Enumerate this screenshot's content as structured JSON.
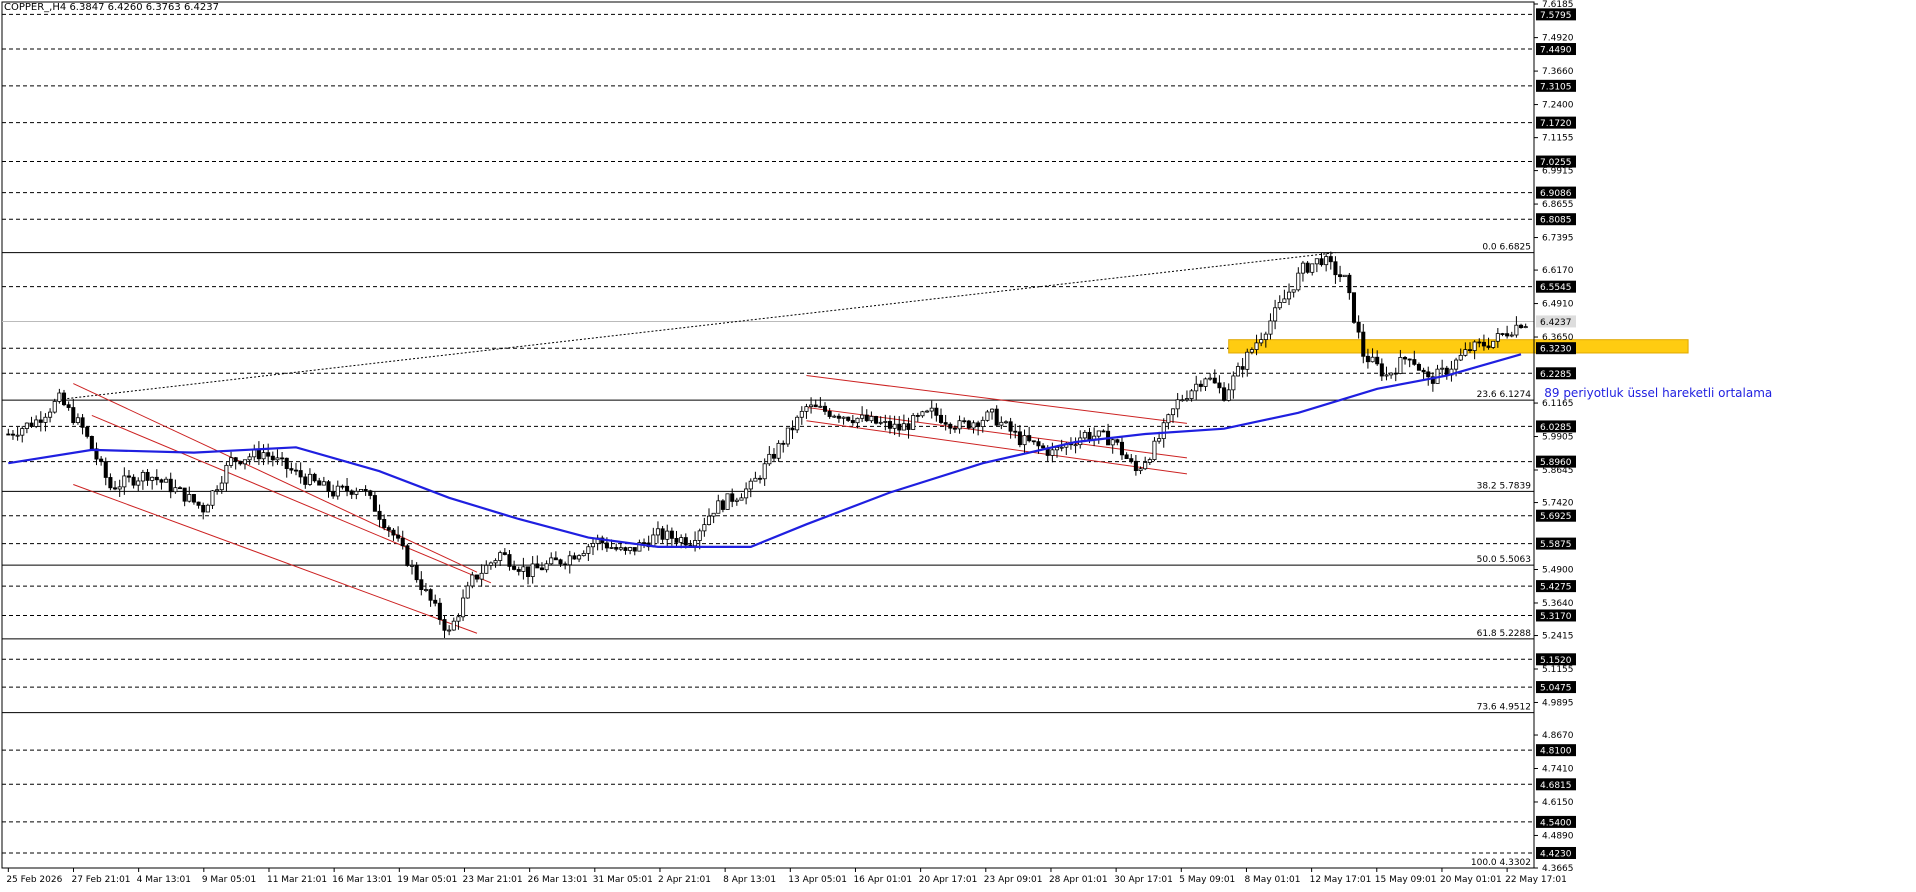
{
  "header": {
    "symbol": "COPPER_,H4",
    "ohlc": "6.3847 6.4260 6.3763 6.4237"
  },
  "colors": {
    "background": "#ffffff",
    "axis": "#000000",
    "grid_dashed": "#000000",
    "candle": "#000000",
    "ema": "#1f1fe0",
    "channel": "#cc2222",
    "zone": "#ffcc11",
    "annotation": "#1f1fe0"
  },
  "chart_data": {
    "type": "candlestick",
    "symbol": "COPPER_",
    "timeframe": "H4",
    "ylim": [
      4.3665,
      7.6185
    ],
    "x_labels": [
      "25 Feb 2026",
      "27 Feb 21:01",
      "4 Mar 13:01",
      "9 Mar 05:01",
      "11 Mar 21:01",
      "16 Mar 13:01",
      "19 Mar 05:01",
      "23 Mar 21:01",
      "26 Mar 13:01",
      "31 Mar 05:01",
      "2 Apr 21:01",
      "8 Apr 13:01",
      "13 Apr 05:01",
      "16 Apr 01:01",
      "20 Apr 17:01",
      "23 Apr 09:01",
      "28 Apr 01:01",
      "30 Apr 17:01",
      "5 May 09:01",
      "8 May 01:01",
      "12 May 17:01",
      "15 May 09:01",
      "20 May 01:01",
      "22 May 17:01"
    ],
    "y_ticks_plain": [
      "7.6185",
      "7.4920",
      "7.3660",
      "7.2400",
      "7.1155",
      "6.9915",
      "6.8655",
      "6.7395",
      "6.6170",
      "6.4910",
      "6.3650",
      "6.1165",
      "5.9905",
      "5.8645",
      "5.7420",
      "5.4900",
      "5.3640",
      "5.2415",
      "5.1155",
      "4.9895",
      "4.8670",
      "4.7410",
      "4.6150",
      "4.4890",
      "4.3665"
    ],
    "levels": [
      {
        "value": 7.5795,
        "label": "7.5795"
      },
      {
        "value": 7.449,
        "label": "7.4490"
      },
      {
        "value": 7.3105,
        "label": "7.3105"
      },
      {
        "value": 7.172,
        "label": "7.1720"
      },
      {
        "value": 7.0255,
        "label": "7.0255"
      },
      {
        "value": 6.9086,
        "label": "6.9086"
      },
      {
        "value": 6.8085,
        "label": "6.8085"
      },
      {
        "value": 6.5545,
        "label": "6.5545"
      },
      {
        "value": 6.323,
        "label": "6.3230"
      },
      {
        "value": 6.2285,
        "label": "6.2285"
      },
      {
        "value": 6.0285,
        "label": "6.0285"
      },
      {
        "value": 5.896,
        "label": "5.8960"
      },
      {
        "value": 5.6925,
        "label": "5.6925"
      },
      {
        "value": 5.5875,
        "label": "5.5875"
      },
      {
        "value": 5.4275,
        "label": "5.4275"
      },
      {
        "value": 5.317,
        "label": "5.3170"
      },
      {
        "value": 5.152,
        "label": "5.1520"
      },
      {
        "value": 5.0475,
        "label": "5.0475"
      },
      {
        "value": 4.81,
        "label": "4.8100"
      },
      {
        "value": 4.6815,
        "label": "4.6815"
      },
      {
        "value": 4.54,
        "label": "4.5400"
      },
      {
        "value": 4.423,
        "label": "4.4230"
      }
    ],
    "current_price": {
      "value": 6.4237,
      "label": "6.4237"
    },
    "fibonacci": [
      {
        "value": 6.6825,
        "label": "0.0 6.6825"
      },
      {
        "value": 6.1274,
        "label": "23.6 6.1274"
      },
      {
        "value": 5.7839,
        "label": "38.2 5.7839"
      },
      {
        "value": 5.5063,
        "label": "50.0 5.5063"
      },
      {
        "value": 5.2288,
        "label": "61.8 5.2288"
      },
      {
        "value": 4.9512,
        "label": "73.6 4.9512"
      },
      {
        "value": 4.3302,
        "label": "100.0 4.3302"
      }
    ],
    "anchors": [
      {
        "t": 0,
        "v": 6.0
      },
      {
        "t": 6,
        "v": 6.05
      },
      {
        "t": 11,
        "v": 6.13
      },
      {
        "t": 16,
        "v": 6.02
      },
      {
        "t": 22,
        "v": 5.8
      },
      {
        "t": 30,
        "v": 5.85
      },
      {
        "t": 37,
        "v": 5.78
      },
      {
        "t": 42,
        "v": 5.72
      },
      {
        "t": 48,
        "v": 5.9
      },
      {
        "t": 55,
        "v": 5.93
      },
      {
        "t": 62,
        "v": 5.85
      },
      {
        "t": 70,
        "v": 5.78
      },
      {
        "t": 76,
        "v": 5.8
      },
      {
        "t": 83,
        "v": 5.62
      },
      {
        "t": 90,
        "v": 5.4
      },
      {
        "t": 95,
        "v": 5.25
      },
      {
        "t": 100,
        "v": 5.45
      },
      {
        "t": 106,
        "v": 5.55
      },
      {
        "t": 112,
        "v": 5.48
      },
      {
        "t": 120,
        "v": 5.53
      },
      {
        "t": 127,
        "v": 5.6
      },
      {
        "t": 133,
        "v": 5.55
      },
      {
        "t": 140,
        "v": 5.62
      },
      {
        "t": 147,
        "v": 5.6
      },
      {
        "t": 152,
        "v": 5.72
      },
      {
        "t": 160,
        "v": 5.8
      },
      {
        "t": 166,
        "v": 5.95
      },
      {
        "t": 172,
        "v": 6.1
      },
      {
        "t": 178,
        "v": 6.08
      },
      {
        "t": 185,
        "v": 6.05
      },
      {
        "t": 192,
        "v": 6.02
      },
      {
        "t": 199,
        "v": 6.08
      },
      {
        "t": 205,
        "v": 6.03
      },
      {
        "t": 212,
        "v": 6.07
      },
      {
        "t": 218,
        "v": 5.98
      },
      {
        "t": 225,
        "v": 5.93
      },
      {
        "t": 232,
        "v": 6.0
      },
      {
        "t": 238,
        "v": 5.98
      },
      {
        "t": 243,
        "v": 5.86
      },
      {
        "t": 247,
        "v": 5.95
      },
      {
        "t": 252,
        "v": 6.12
      },
      {
        "t": 258,
        "v": 6.22
      },
      {
        "t": 262,
        "v": 6.15
      },
      {
        "t": 268,
        "v": 6.32
      },
      {
        "t": 274,
        "v": 6.48
      },
      {
        "t": 279,
        "v": 6.62
      },
      {
        "t": 283,
        "v": 6.66
      },
      {
        "t": 288,
        "v": 6.58
      },
      {
        "t": 292,
        "v": 6.3
      },
      {
        "t": 297,
        "v": 6.22
      },
      {
        "t": 302,
        "v": 6.3
      },
      {
        "t": 306,
        "v": 6.2
      },
      {
        "t": 310,
        "v": 6.24
      },
      {
        "t": 315,
        "v": 6.32
      },
      {
        "t": 320,
        "v": 6.35
      },
      {
        "t": 326,
        "v": 6.42
      }
    ],
    "ema": {
      "name": "89 periyotluk üssel hareketli ortalama",
      "points": [
        {
          "t": 0,
          "v": 5.89
        },
        {
          "t": 18,
          "v": 5.94
        },
        {
          "t": 40,
          "v": 5.93
        },
        {
          "t": 62,
          "v": 5.95
        },
        {
          "t": 80,
          "v": 5.86
        },
        {
          "t": 95,
          "v": 5.76
        },
        {
          "t": 110,
          "v": 5.68
        },
        {
          "t": 125,
          "v": 5.61
        },
        {
          "t": 140,
          "v": 5.575
        },
        {
          "t": 160,
          "v": 5.575
        },
        {
          "t": 172,
          "v": 5.66
        },
        {
          "t": 190,
          "v": 5.78
        },
        {
          "t": 210,
          "v": 5.89
        },
        {
          "t": 230,
          "v": 5.97
        },
        {
          "t": 245,
          "v": 6.0
        },
        {
          "t": 262,
          "v": 6.02
        },
        {
          "t": 278,
          "v": 6.08
        },
        {
          "t": 295,
          "v": 6.17
        },
        {
          "t": 310,
          "v": 6.22
        },
        {
          "t": 326,
          "v": 6.3
        }
      ]
    },
    "trendlines": [
      {
        "kind": "channel-upper",
        "from": {
          "t": 14,
          "v": 6.19
        },
        "to": {
          "t": 101,
          "v": 5.48
        }
      },
      {
        "kind": "channel-lower",
        "from": {
          "t": 14,
          "v": 5.81
        },
        "to": {
          "t": 101,
          "v": 5.25
        }
      },
      {
        "kind": "channel-mid",
        "from": {
          "t": 18,
          "v": 6.07
        },
        "to": {
          "t": 104,
          "v": 5.44
        }
      },
      {
        "kind": "flag-upper",
        "from": {
          "t": 172,
          "v": 6.22
        },
        "to": {
          "t": 254,
          "v": 6.04
        }
      },
      {
        "kind": "flag-mid",
        "from": {
          "t": 172,
          "v": 6.1
        },
        "to": {
          "t": 254,
          "v": 5.91
        }
      },
      {
        "kind": "flag-lower",
        "from": {
          "t": 172,
          "v": 6.05
        },
        "to": {
          "t": 254,
          "v": 5.85
        }
      }
    ],
    "fib_leg": {
      "from": {
        "t": 11,
        "v": 6.13
      },
      "to": {
        "t": 286,
        "v": 6.6825
      }
    },
    "zone": {
      "t_start": 263,
      "t_end": 362,
      "v_high": 6.355,
      "v_low": 6.305
    },
    "annotation": {
      "text": "89 periyotluk üssel hareketli ortalama",
      "t": 331,
      "v": 6.14
    },
    "n_bars": 328
  }
}
